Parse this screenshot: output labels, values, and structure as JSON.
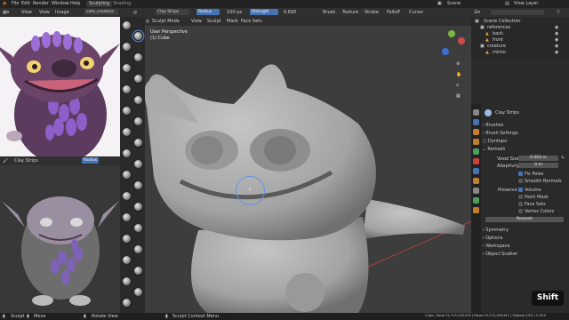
{
  "topbar": {
    "menus": [
      "File",
      "Edit",
      "Render",
      "Window",
      "Help"
    ],
    "tabs": [
      "Sculpting",
      "Shading"
    ],
    "active_tab": "Sculpting",
    "scene_label": "Scene",
    "view_layer_label": "View Layer"
  },
  "image_editor": {
    "menus": [
      "View",
      "View",
      "Image"
    ],
    "image_name": "cute_creature",
    "footer_name": "Clay Strips",
    "footer_btn": "Radius"
  },
  "viewport": {
    "mode": "Sculpt Mode",
    "menus": [
      "View",
      "Sculpt",
      "Mask",
      "Face Sets"
    ],
    "brush_name": "Clay Strips",
    "radius_label": "Radius",
    "radius_value": "100 px",
    "strength_label": "Strength",
    "strength_value": "0.600",
    "right_menus": [
      "Brush",
      "Texture",
      "Stroke",
      "Falloff",
      "Cursor"
    ],
    "overlay_title": "User Perspective",
    "overlay_object": "(1) Cube"
  },
  "outliner": {
    "title": "Scene Collection",
    "items": [
      {
        "label": "references",
        "indent": 1
      },
      {
        "label": "back",
        "indent": 2
      },
      {
        "label": "front",
        "indent": 2
      },
      {
        "label": "creature",
        "indent": 1
      },
      {
        "label": "mirror",
        "indent": 2
      }
    ]
  },
  "properties": {
    "brush_label": "Clay Strips",
    "sections": {
      "brushes": "Brushes",
      "brush_settings": "Brush Settings",
      "dyntopo": "Dyntopo",
      "remesh": "Remesh",
      "symmetry": "Symmetry",
      "options": "Options",
      "workspace": "Workspace",
      "object_scatter": "Object Scatter"
    },
    "voxel_size_label": "Voxel Size",
    "voxel_size_value": "0.003 m",
    "adaptivity_label": "Adaptivity",
    "adaptivity_value": "0 m",
    "fix_poles": "Fix Poles",
    "smooth_normals": "Smooth Normals",
    "preserve_label": "Preserve",
    "preserve_items": [
      "Volume",
      "Paint Mask",
      "Face Sets",
      "Vertex Colors"
    ],
    "remesh_button": "Remesh"
  },
  "statusbar": {
    "left_items": [
      "Sculpt",
      "Move",
      "Rotate View",
      "Sculpt Context Menu"
    ],
    "right_text": "Cube | Verts:72,713,176,019 | Faces:72,713,169,947 | Objects:1/23 | 2.93.0"
  },
  "badge": "Shift",
  "colors": {
    "accent": "#4772b3",
    "mesh": "#a6a6a6",
    "viewport_bg": "#3d3d3d"
  }
}
